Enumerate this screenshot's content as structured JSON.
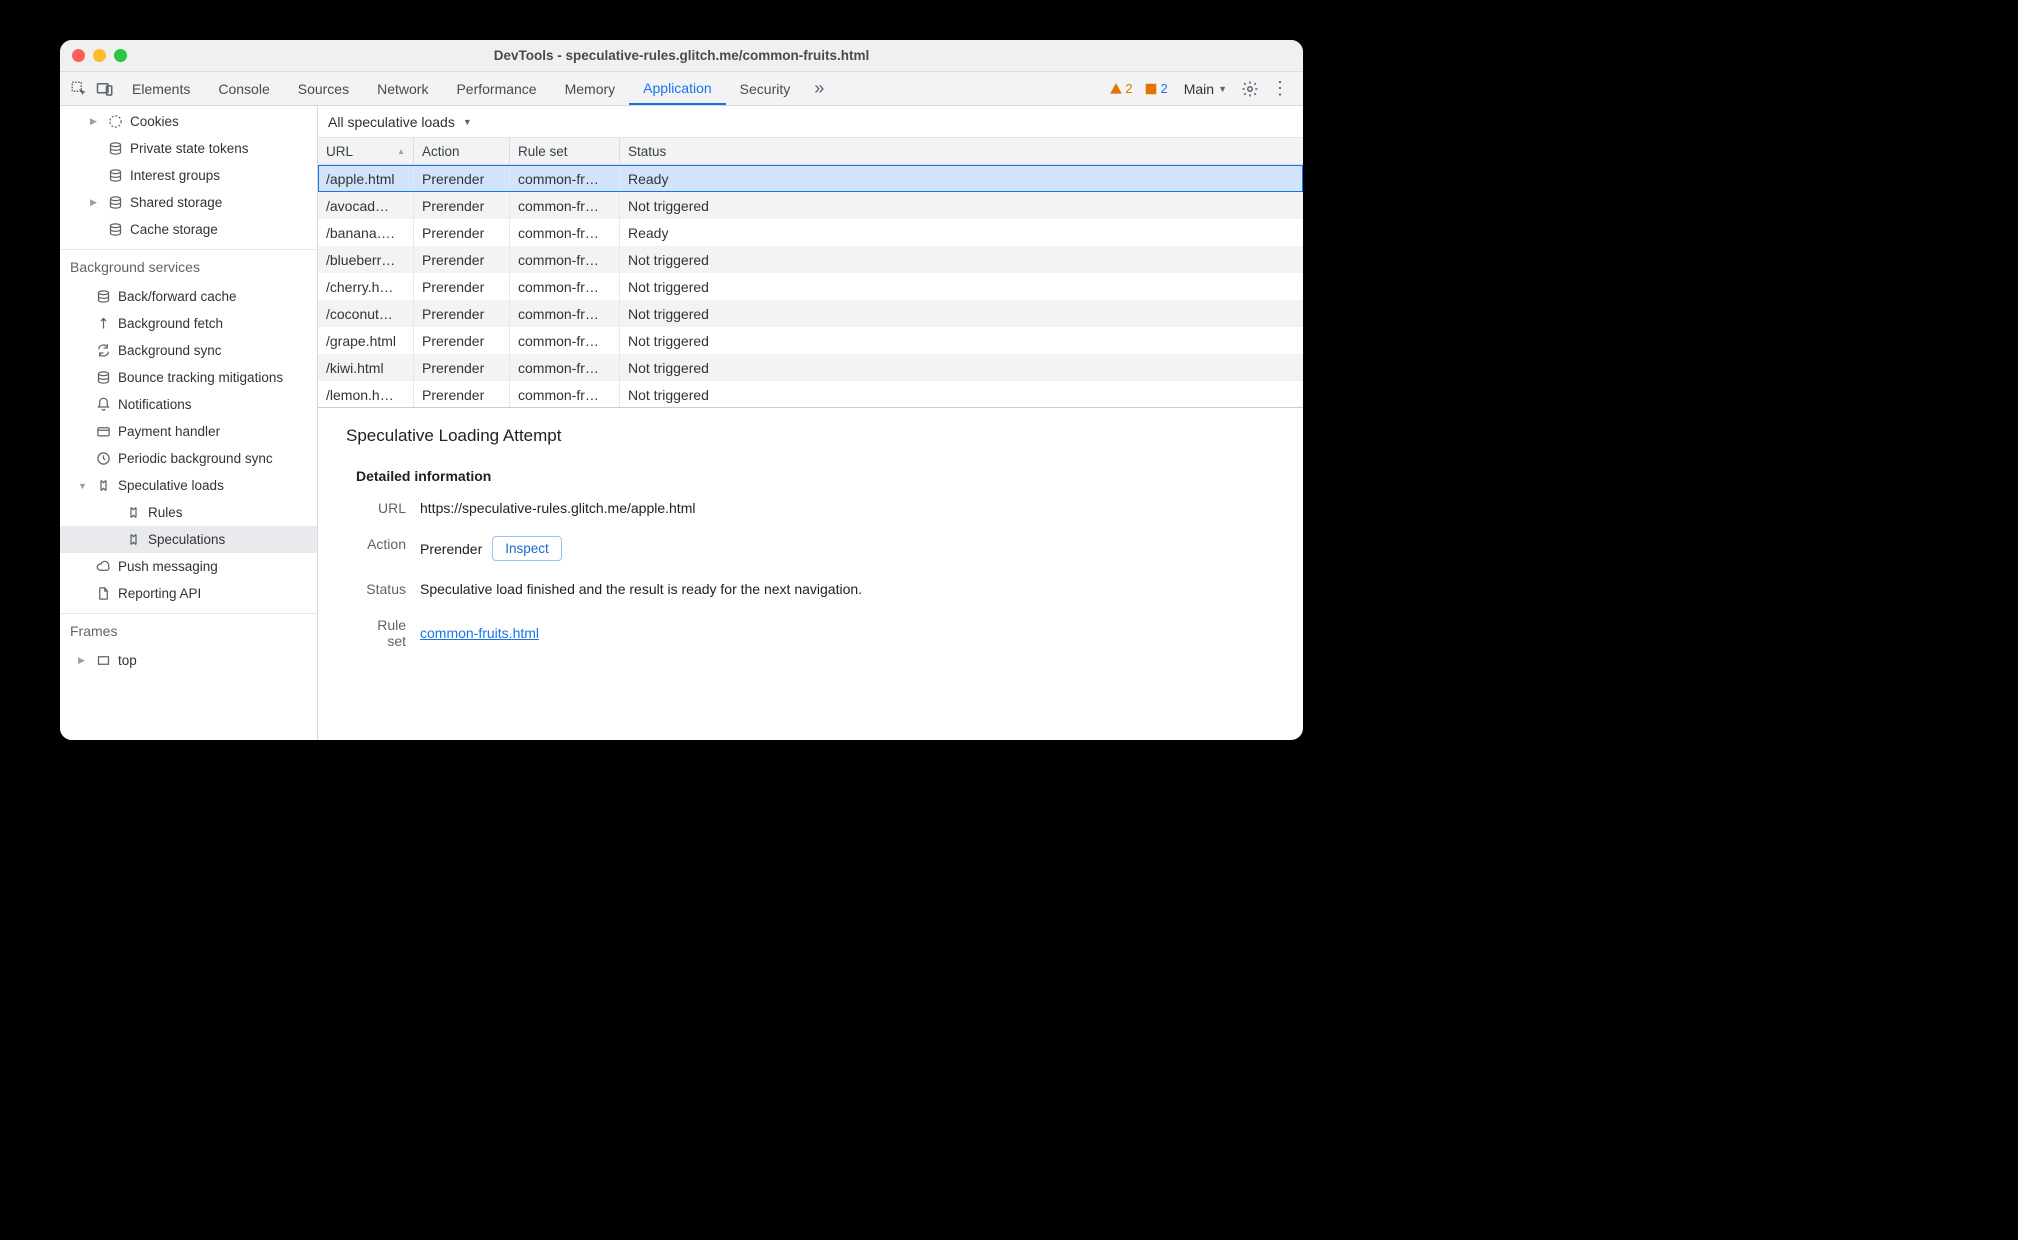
{
  "window": {
    "title": "DevTools - speculative-rules.glitch.me/common-fruits.html"
  },
  "tabs": {
    "items": [
      "Elements",
      "Console",
      "Sources",
      "Network",
      "Performance",
      "Memory",
      "Application",
      "Security"
    ],
    "active": "Application",
    "warnings": "2",
    "infos": "2",
    "target": "Main"
  },
  "sidebar": {
    "storage": [
      {
        "icon": "cookie",
        "label": "Cookies",
        "caret": true
      },
      {
        "icon": "db",
        "label": "Private state tokens"
      },
      {
        "icon": "db",
        "label": "Interest groups"
      },
      {
        "icon": "db",
        "label": "Shared storage",
        "caret": true
      },
      {
        "icon": "db",
        "label": "Cache storage"
      }
    ],
    "bg_header": "Background services",
    "bg": [
      {
        "icon": "db",
        "label": "Back/forward cache"
      },
      {
        "icon": "arrow",
        "label": "Background fetch"
      },
      {
        "icon": "sync",
        "label": "Background sync"
      },
      {
        "icon": "db",
        "label": "Bounce tracking mitigations"
      },
      {
        "icon": "bell",
        "label": "Notifications"
      },
      {
        "icon": "card",
        "label": "Payment handler"
      },
      {
        "icon": "clock",
        "label": "Periodic background sync"
      },
      {
        "icon": "spec",
        "label": "Speculative loads",
        "caret": true,
        "open": true,
        "children": [
          {
            "icon": "spec",
            "label": "Rules"
          },
          {
            "icon": "spec",
            "label": "Speculations",
            "selected": true
          }
        ]
      },
      {
        "icon": "cloud",
        "label": "Push messaging"
      },
      {
        "icon": "file",
        "label": "Reporting API"
      }
    ],
    "frames_header": "Frames",
    "frames": [
      {
        "icon": "frame",
        "label": "top",
        "caret": true
      }
    ]
  },
  "filter": {
    "label": "All speculative loads"
  },
  "columns": {
    "url": "URL",
    "action": "Action",
    "ruleset": "Rule set",
    "status": "Status"
  },
  "rows": [
    {
      "url": "/apple.html",
      "action": "Prerender",
      "ruleset": "common-fr…",
      "status": "Ready",
      "selected": true
    },
    {
      "url": "/avocad…",
      "action": "Prerender",
      "ruleset": "common-fr…",
      "status": "Not triggered"
    },
    {
      "url": "/banana….",
      "action": "Prerender",
      "ruleset": "common-fr…",
      "status": "Ready"
    },
    {
      "url": "/blueberr…",
      "action": "Prerender",
      "ruleset": "common-fr…",
      "status": "Not triggered"
    },
    {
      "url": "/cherry.h…",
      "action": "Prerender",
      "ruleset": "common-fr…",
      "status": "Not triggered"
    },
    {
      "url": "/coconut…",
      "action": "Prerender",
      "ruleset": "common-fr…",
      "status": "Not triggered"
    },
    {
      "url": "/grape.html",
      "action": "Prerender",
      "ruleset": "common-fr…",
      "status": "Not triggered"
    },
    {
      "url": "/kiwi.html",
      "action": "Prerender",
      "ruleset": "common-fr…",
      "status": "Not triggered"
    },
    {
      "url": "/lemon.h…",
      "action": "Prerender",
      "ruleset": "common-fr…",
      "status": "Not triggered"
    }
  ],
  "detail": {
    "title": "Speculative Loading Attempt",
    "subhead": "Detailed information",
    "url_label": "URL",
    "url_value": "https://speculative-rules.glitch.me/apple.html",
    "action_label": "Action",
    "action_value": "Prerender",
    "inspect": "Inspect",
    "status_label": "Status",
    "status_value": "Speculative load finished and the result is ready for the next navigation.",
    "ruleset_label": "Rule set",
    "ruleset_link": "common-fruits.html"
  }
}
